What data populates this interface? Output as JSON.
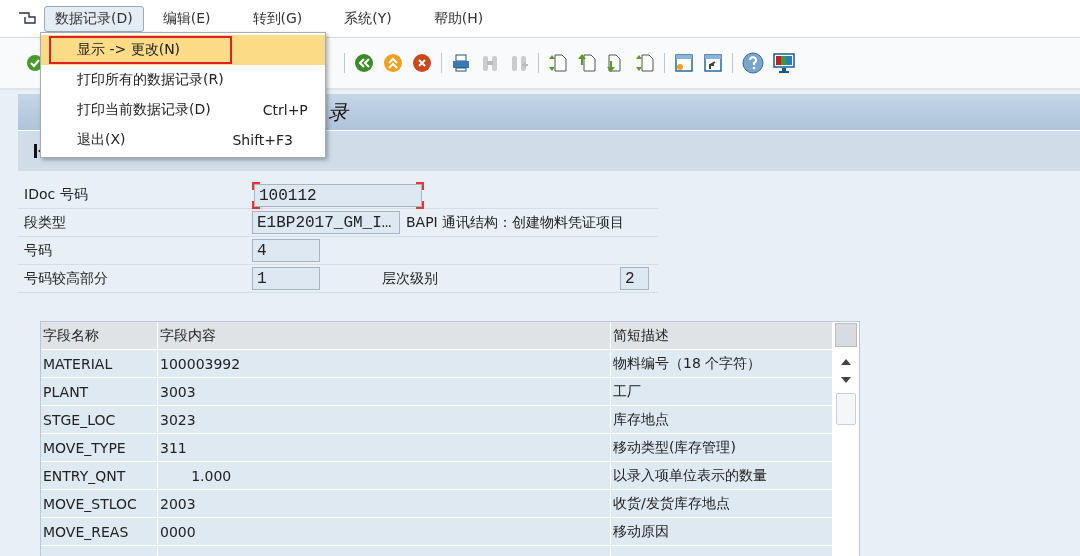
{
  "menu_bar": [
    {
      "label": "数据记录(D)",
      "selected": true
    },
    {
      "label": "编辑(E)",
      "selected": false
    },
    {
      "label": "转到(G)",
      "selected": false
    },
    {
      "label": "系统(Y)",
      "selected": false
    },
    {
      "label": "帮助(H)",
      "selected": false
    }
  ],
  "dropdown": [
    {
      "label": "显示 -> 更改(N)",
      "selected": true
    },
    {
      "label": "打印所有的数据记录(R)",
      "selected": false
    },
    {
      "label": "打印当前数据记录(D)",
      "shortcut": "Ctrl+P",
      "selected": false
    },
    {
      "label": "退出(X)",
      "shortcut": "Shift+F3",
      "selected": false
    }
  ],
  "title": "录",
  "form": {
    "idoc_label": "IDoc 号码",
    "idoc_value": "100112",
    "segment_label": "段类型",
    "segment_value": "E1BP2017_GM_I…",
    "segment_desc": "BAPI 通讯结构：创建物料凭证项目",
    "number_label": "号码",
    "number_value": "4",
    "high_label": "号码较高部分",
    "high_value": "1",
    "level_label": "层次级别",
    "level_value": "2"
  },
  "table": {
    "columns": [
      "字段名称",
      "字段内容",
      "简短描述"
    ],
    "rows": [
      [
        "MATERIAL",
        "100003992",
        "物料编号（18 个字符）"
      ],
      [
        "PLANT",
        "3003",
        "工厂"
      ],
      [
        "STGE_LOC",
        "3023",
        "库存地点"
      ],
      [
        "MOVE_TYPE",
        "311",
        "移动类型(库存管理)"
      ],
      [
        "ENTRY_QNT",
        "       1.000",
        "以录入项单位表示的数量"
      ],
      [
        "MOVE_STLOC",
        "2003",
        "收货/发货库存地点"
      ],
      [
        "MOVE_REAS",
        "0000",
        "移动原因"
      ]
    ]
  }
}
